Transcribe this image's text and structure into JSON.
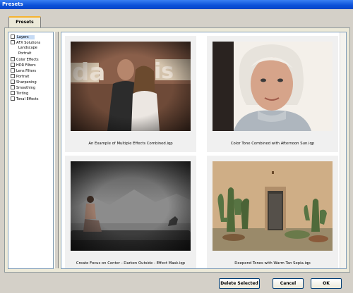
{
  "window": {
    "title": "Presets"
  },
  "tabs": [
    {
      "label": "Presets"
    }
  ],
  "tree": {
    "items": [
      {
        "label": "Layers",
        "level": 0,
        "checkbox": true,
        "selected": true
      },
      {
        "label": "AFX Solutions",
        "level": 0,
        "checkbox": true
      },
      {
        "label": "Landscape",
        "level": 1,
        "checkbox": false
      },
      {
        "label": "Portrait",
        "level": 1,
        "checkbox": false
      },
      {
        "label": "Color Effects",
        "level": 0,
        "checkbox": true
      },
      {
        "label": "HDR Filters",
        "level": 0,
        "checkbox": true
      },
      {
        "label": "Lens Filters",
        "level": 0,
        "checkbox": true
      },
      {
        "label": "Portrait",
        "level": 0,
        "checkbox": true
      },
      {
        "label": "Sharpening",
        "level": 0,
        "checkbox": true
      },
      {
        "label": "Smoothing",
        "level": 0,
        "checkbox": true
      },
      {
        "label": "Tinting",
        "level": 0,
        "checkbox": true
      },
      {
        "label": "Tonal Effects",
        "level": 0,
        "checkbox": true
      }
    ]
  },
  "gallery": {
    "items": [
      {
        "caption": "An Example of Multiple Effects Combined.iqp",
        "image": "couple-graffiti-photo"
      },
      {
        "caption": "Color Tone Combined with Afternoon Sun.iqp",
        "image": "elderly-woman-portrait-photo"
      },
      {
        "caption": "Create Focus on Center - Darken Outside - Effect Mask.iqp",
        "image": "woman-on-log-mountains-photo"
      },
      {
        "caption": "Deepend Tones with Warm Tan Sepia.iqp",
        "image": "adobe-house-cactus-photo"
      }
    ]
  },
  "buttons": {
    "delete": "Delete Selected",
    "cancel": "Cancel",
    "ok": "OK"
  }
}
